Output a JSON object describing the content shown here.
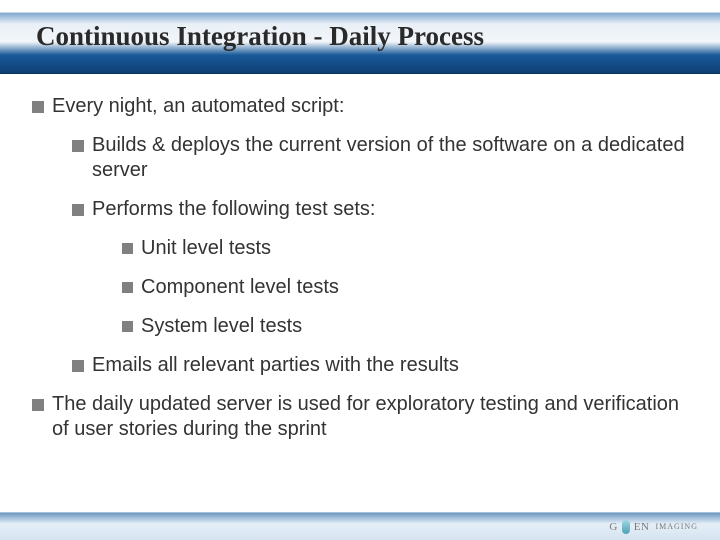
{
  "title": "Continuous Integration - Daily Process",
  "bullets": {
    "b1": "Every night, an automated script:",
    "b1_1": "Builds & deploys the current version of the software on a dedicated server",
    "b1_2": "Performs the following test sets:",
    "b1_2_1": "Unit level tests",
    "b1_2_2": "Component level tests",
    "b1_2_3": "System level tests",
    "b1_3": "Emails all relevant parties with the results",
    "b2": "The daily updated server is used for exploratory testing and verification of user stories during the sprint"
  },
  "footer": {
    "brand_left": "G",
    "brand_right": "EN",
    "brand_sub": "IMAGING"
  }
}
